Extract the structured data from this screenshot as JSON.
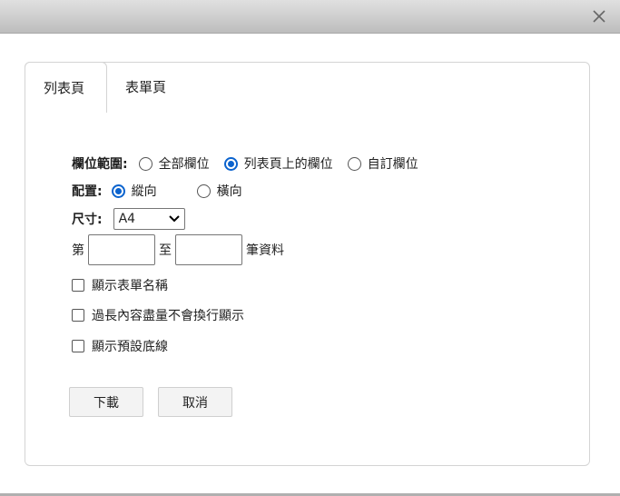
{
  "tabs": [
    {
      "label": "列表頁",
      "active": true
    },
    {
      "label": "表單頁",
      "active": false
    }
  ],
  "field_range": {
    "label": "欄位範圍:",
    "options": [
      {
        "label": "全部欄位",
        "selected": false
      },
      {
        "label": "列表頁上的欄位",
        "selected": true
      },
      {
        "label": "自訂欄位",
        "selected": false
      }
    ]
  },
  "orientation": {
    "label": "配置:",
    "options": [
      {
        "label": "縱向",
        "selected": true
      },
      {
        "label": "橫向",
        "selected": false
      }
    ]
  },
  "size": {
    "label": "尺寸:",
    "value": "A4"
  },
  "range": {
    "prefix": "第",
    "middle": "至",
    "suffix": "筆資料",
    "from_value": "",
    "to_value": ""
  },
  "checkboxes": [
    {
      "label": "顯示表單名稱",
      "checked": false
    },
    {
      "label": "過長內容盡量不會換行顯示",
      "checked": false
    },
    {
      "label": "顯示預設底線",
      "checked": false
    }
  ],
  "buttons": {
    "download": "下載",
    "cancel": "取消"
  },
  "colors": {
    "accent": "#0b63ce",
    "titlebar": "#c8c8c8"
  }
}
